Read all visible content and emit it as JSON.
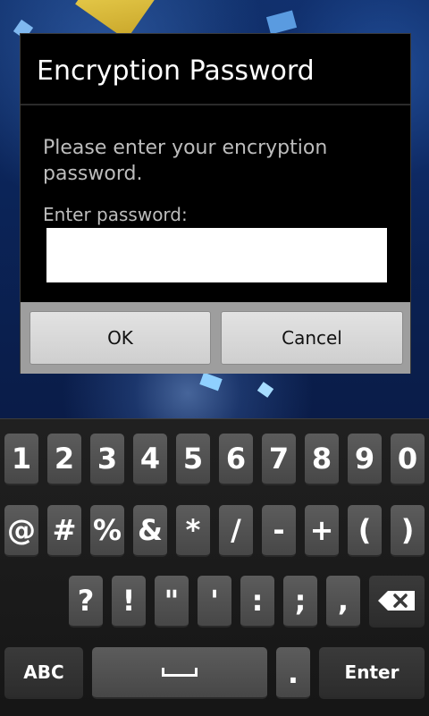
{
  "dialog": {
    "title": "Encryption Password",
    "message": "Please enter your encryption password.",
    "password_label": "Enter password:",
    "password_value": "",
    "ok_label": "OK",
    "cancel_label": "Cancel"
  },
  "keyboard": {
    "row1": [
      "1",
      "2",
      "3",
      "4",
      "5",
      "6",
      "7",
      "8",
      "9",
      "0"
    ],
    "row2": [
      "@",
      "#",
      "%",
      "&",
      "*",
      "/",
      "-",
      "+",
      "(",
      ")"
    ],
    "row3": [
      "?",
      "!",
      "\"",
      "'",
      ":",
      ";",
      ","
    ],
    "abc_label": "ABC",
    "period_label": ".",
    "enter_label": "Enter",
    "delete_icon": "backspace-icon",
    "space_icon": "space-bar-icon"
  },
  "colors": {
    "dialog_bg": "#000000",
    "button_bar": "#9e9e9e",
    "key_bg": "#4f4f4f",
    "keyboard_bg": "#1c1c1c"
  }
}
